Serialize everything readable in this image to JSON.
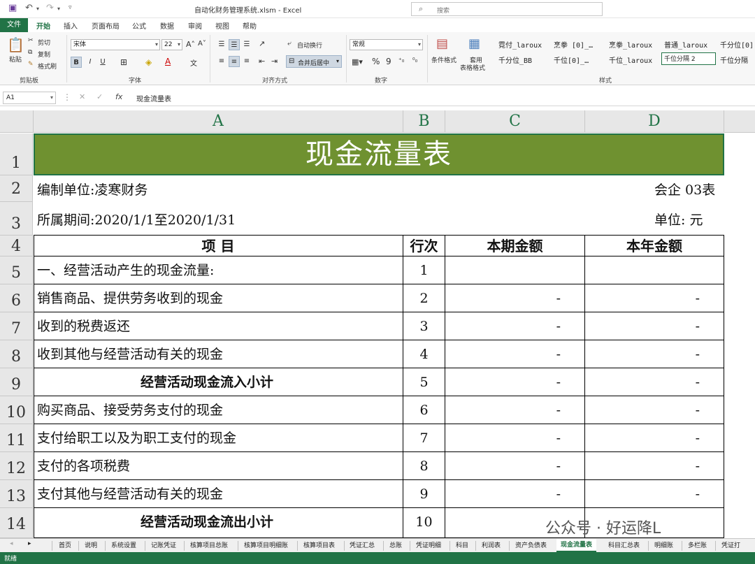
{
  "window": {
    "title": "自动化财务管理系统.xlsm  -  Excel",
    "search_placeholder": "搜索"
  },
  "ribbon_tabs": [
    "文件",
    "开始",
    "插入",
    "页面布局",
    "公式",
    "数据",
    "审阅",
    "视图",
    "帮助"
  ],
  "ribbon": {
    "clipboard": {
      "paste": "粘贴",
      "cut": "剪切",
      "copy": "复制",
      "format_painter": "格式刷",
      "label": "剪贴板"
    },
    "font": {
      "name": "宋体",
      "size": "22",
      "label": "字体",
      "bold": "B",
      "italic": "I",
      "underline": "U"
    },
    "alignment": {
      "wrap": "自动换行",
      "merge": "合并后居中",
      "label": "对齐方式"
    },
    "number": {
      "format": "常规",
      "percent": "%",
      "comma": "9",
      "label": "数字"
    },
    "styles": {
      "conditional": "条件格式",
      "table_format_1": "套用",
      "table_format_2": "表格格式",
      "label": "样式",
      "row1": [
        "霓付_laroux",
        "烹拳 [0]_…",
        "烹拳_laroux",
        "普通_laroux",
        "千分位[0]"
      ],
      "row2": [
        "千分位_BB",
        "千位[0]_…",
        "千位_laroux",
        "千位分隔 2",
        "千位分隔"
      ]
    }
  },
  "formula_bar": {
    "cell_ref": "A1",
    "formula": "现金流量表"
  },
  "columns": [
    "A",
    "B",
    "C",
    "D"
  ],
  "rows": [
    "1",
    "2",
    "3",
    "4",
    "5",
    "6",
    "7",
    "8",
    "9",
    "10",
    "11",
    "12",
    "13",
    "14"
  ],
  "sheet": {
    "title": "现金流量表",
    "company": "编制单位:凌寒财务",
    "form_no": "会企 03表",
    "period": "所属期间:2020/1/1至2020/1/31",
    "unit": "单位:  元",
    "headers": [
      "项  目",
      "行次",
      "本期金额",
      "本年金额"
    ],
    "items": [
      {
        "label": "一、经营活动产生的现金流量:",
        "line": "1",
        "current": "",
        "ytd": "",
        "bold": false,
        "indent": false
      },
      {
        "label": "销售商品、提供劳务收到的现金",
        "line": "2",
        "current": "-",
        "ytd": "-",
        "bold": false,
        "indent": false
      },
      {
        "label": "收到的税费返还",
        "line": "3",
        "current": "-",
        "ytd": "-",
        "bold": false,
        "indent": false
      },
      {
        "label": "收到其他与经营活动有关的现金",
        "line": "4",
        "current": "-",
        "ytd": "-",
        "bold": false,
        "indent": false
      },
      {
        "label": "经营活动现金流入小计",
        "line": "5",
        "current": "-",
        "ytd": "-",
        "bold": true,
        "indent": true
      },
      {
        "label": "购买商品、接受劳务支付的现金",
        "line": "6",
        "current": "-",
        "ytd": "-",
        "bold": false,
        "indent": false
      },
      {
        "label": "支付给职工以及为职工支付的现金",
        "line": "7",
        "current": "-",
        "ytd": "-",
        "bold": false,
        "indent": false
      },
      {
        "label": "支付的各项税费",
        "line": "8",
        "current": "-",
        "ytd": "-",
        "bold": false,
        "indent": false
      },
      {
        "label": "支付其他与经营活动有关的现金",
        "line": "9",
        "current": "-",
        "ytd": "-",
        "bold": false,
        "indent": false
      },
      {
        "label": "经营活动现金流出小计",
        "line": "10",
        "current": "",
        "ytd": "",
        "bold": true,
        "indent": true
      }
    ]
  },
  "sheet_tabs": [
    "首页",
    "说明",
    "系统设置",
    "记账凭证",
    "核算项目总账",
    "核算项目明细账",
    "核算项目表",
    "凭证汇总",
    "总账",
    "凭证明细",
    "科目",
    "利润表",
    "资产负债表",
    "现金流量表",
    "科目汇总表",
    "明细账",
    "多栏账",
    "凭证打"
  ],
  "active_sheet": "现金流量表",
  "status": "就绪",
  "watermark": "公众号 · 好运降L",
  "colors": {
    "accent": "#217346",
    "title_fill": "#6f9130"
  }
}
